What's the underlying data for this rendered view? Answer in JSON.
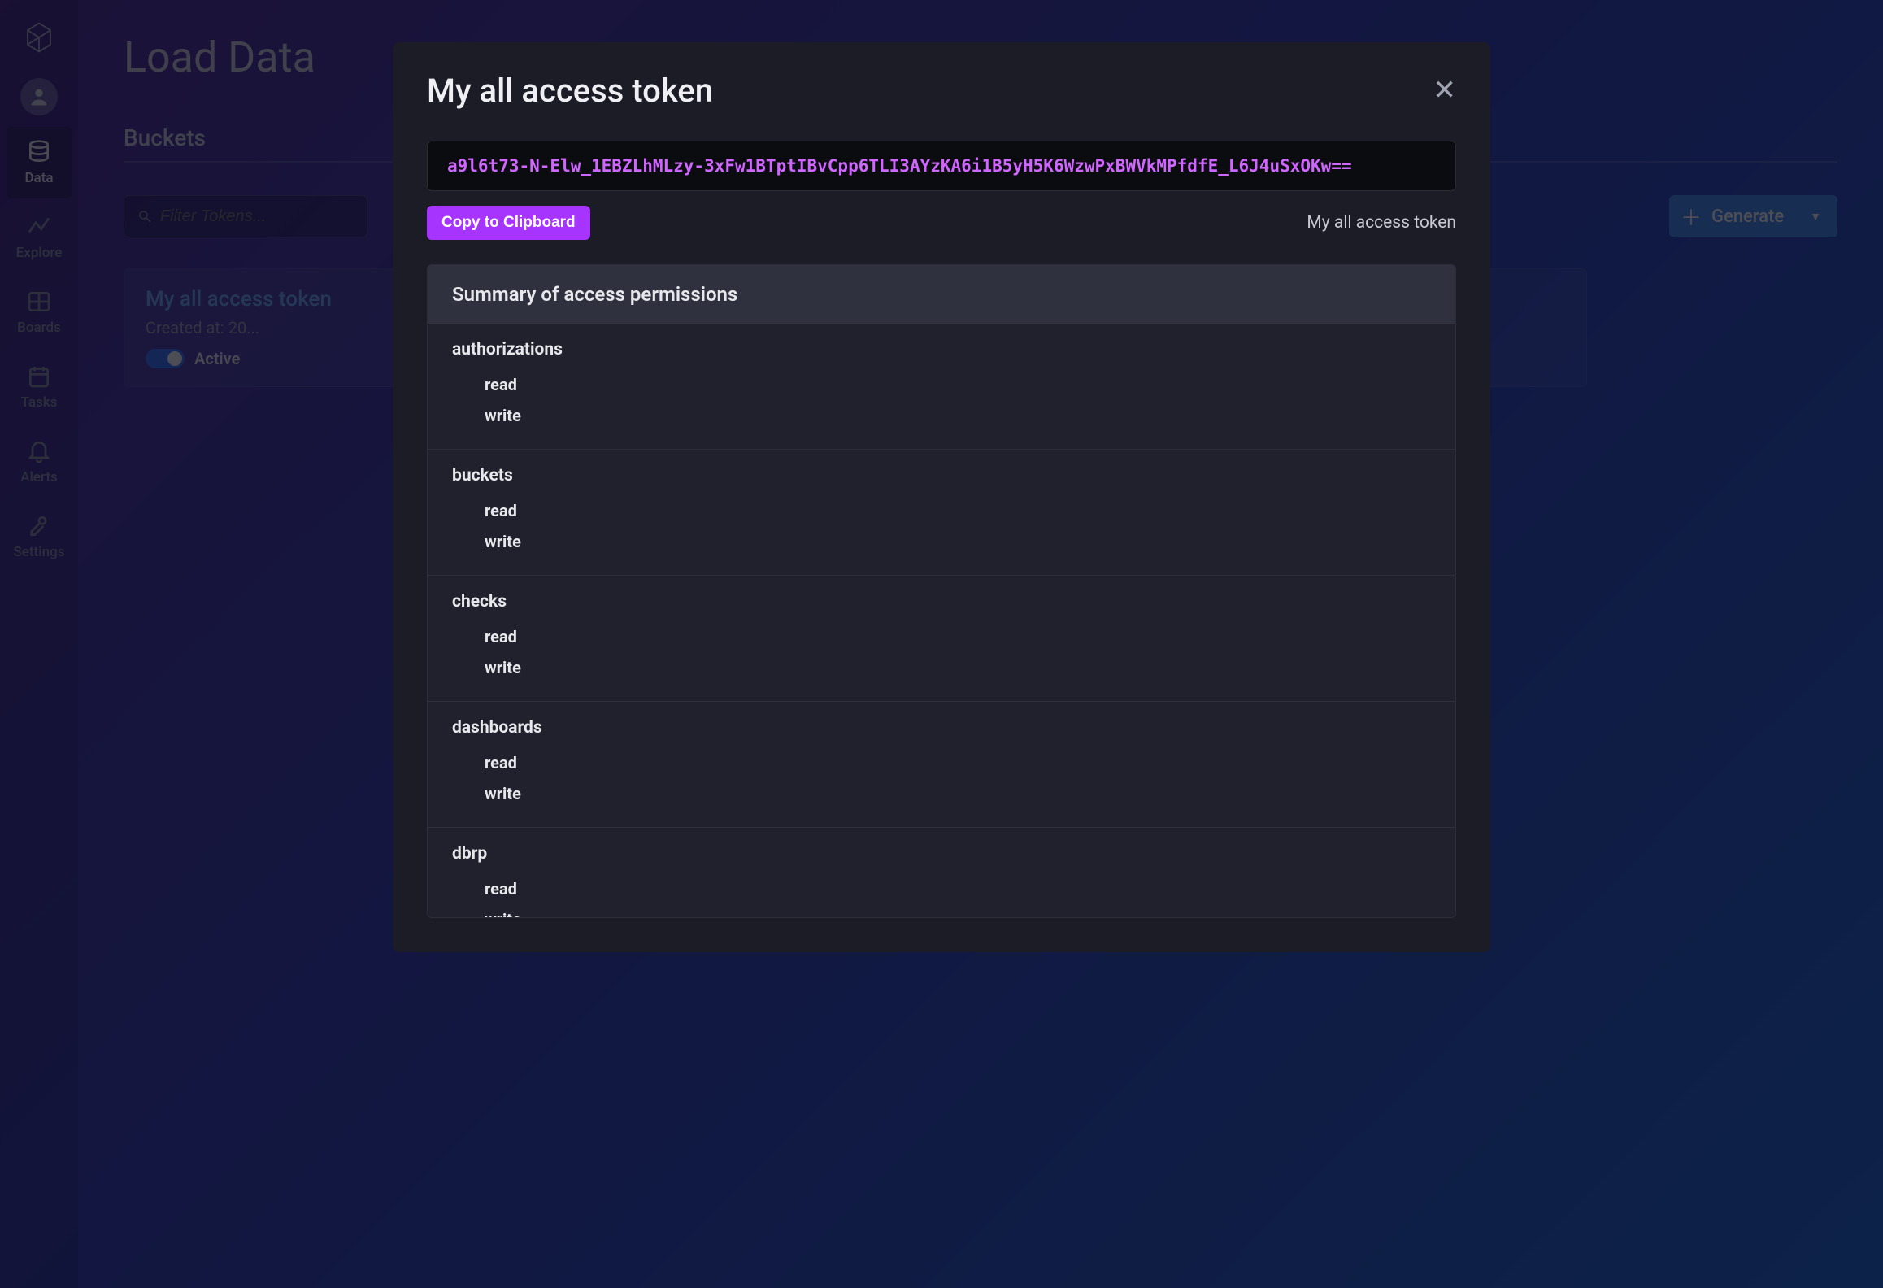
{
  "sidebar": {
    "items": [
      {
        "label": "Data"
      },
      {
        "label": "Explore"
      },
      {
        "label": "Boards"
      },
      {
        "label": "Tasks"
      },
      {
        "label": "Alerts"
      },
      {
        "label": "Settings"
      }
    ]
  },
  "page": {
    "title": "Load Data",
    "tab_buckets": "Buckets",
    "search_placeholder": "Filter Tokens...",
    "generate_button": "Generate"
  },
  "token_card": {
    "name": "My all access token",
    "created_at": "Created at: 20...",
    "status_label": "Active"
  },
  "modal": {
    "title": "My all access token",
    "token_value": "a9l6t73-N-Elw_1EBZLhMLzy-3xFw1BTptIBvCpp6TLI3AYzKA6i1B5yH5K6WzwPxBWVkMPfdfE_L6J4uSxOKw==",
    "copy_button": "Copy to Clipboard",
    "token_name_right": "My all access token",
    "permissions_heading": "Summary of access permissions",
    "permissions": [
      {
        "resource": "authorizations",
        "actions": [
          "read",
          "write"
        ]
      },
      {
        "resource": "buckets",
        "actions": [
          "read",
          "write"
        ]
      },
      {
        "resource": "checks",
        "actions": [
          "read",
          "write"
        ]
      },
      {
        "resource": "dashboards",
        "actions": [
          "read",
          "write"
        ]
      },
      {
        "resource": "dbrp",
        "actions": [
          "read",
          "write"
        ]
      }
    ]
  }
}
